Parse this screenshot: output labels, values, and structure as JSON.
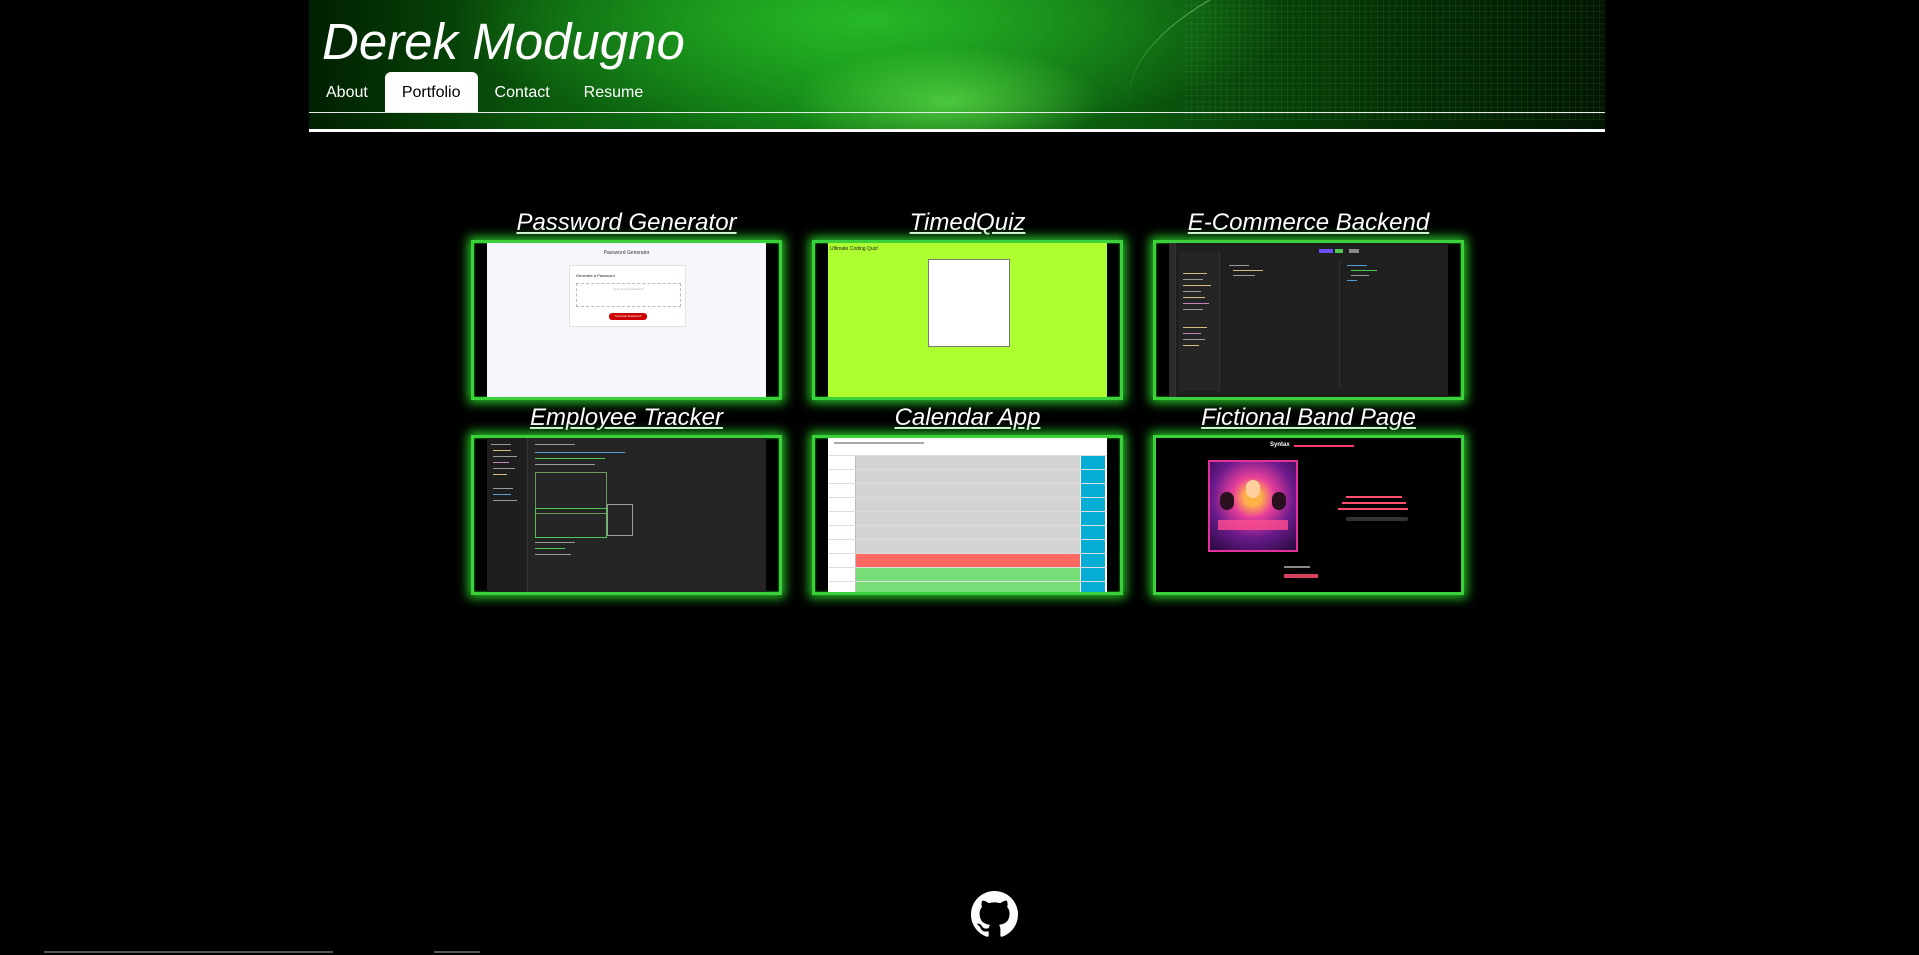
{
  "header": {
    "site_title": "Derek Modugno",
    "nav": [
      {
        "label": "About",
        "active": false
      },
      {
        "label": "Portfolio",
        "active": true
      },
      {
        "label": "Contact",
        "active": false
      },
      {
        "label": "Resume",
        "active": false
      }
    ]
  },
  "portfolio": {
    "projects": [
      {
        "title": "Password Generator",
        "preview": {
          "heading": "Password Generator",
          "card_label": "Generate a Password",
          "placeholder": "Your Secure Password",
          "button": "Generate Password"
        }
      },
      {
        "title": "TimedQuiz",
        "preview": {
          "heading": "Ultimate Coding Quiz!"
        }
      },
      {
        "title": "E-Commerce Backend"
      },
      {
        "title": "Employee Tracker"
      },
      {
        "title": "Calendar App"
      },
      {
        "title": "Fictional Band Page",
        "preview": {
          "band_name": "Syntax"
        }
      }
    ]
  },
  "footer": {
    "icon": "github-icon"
  },
  "colors": {
    "accent_glow": "#3ad13a",
    "background": "#000000",
    "active_tab": "#ffffff"
  }
}
